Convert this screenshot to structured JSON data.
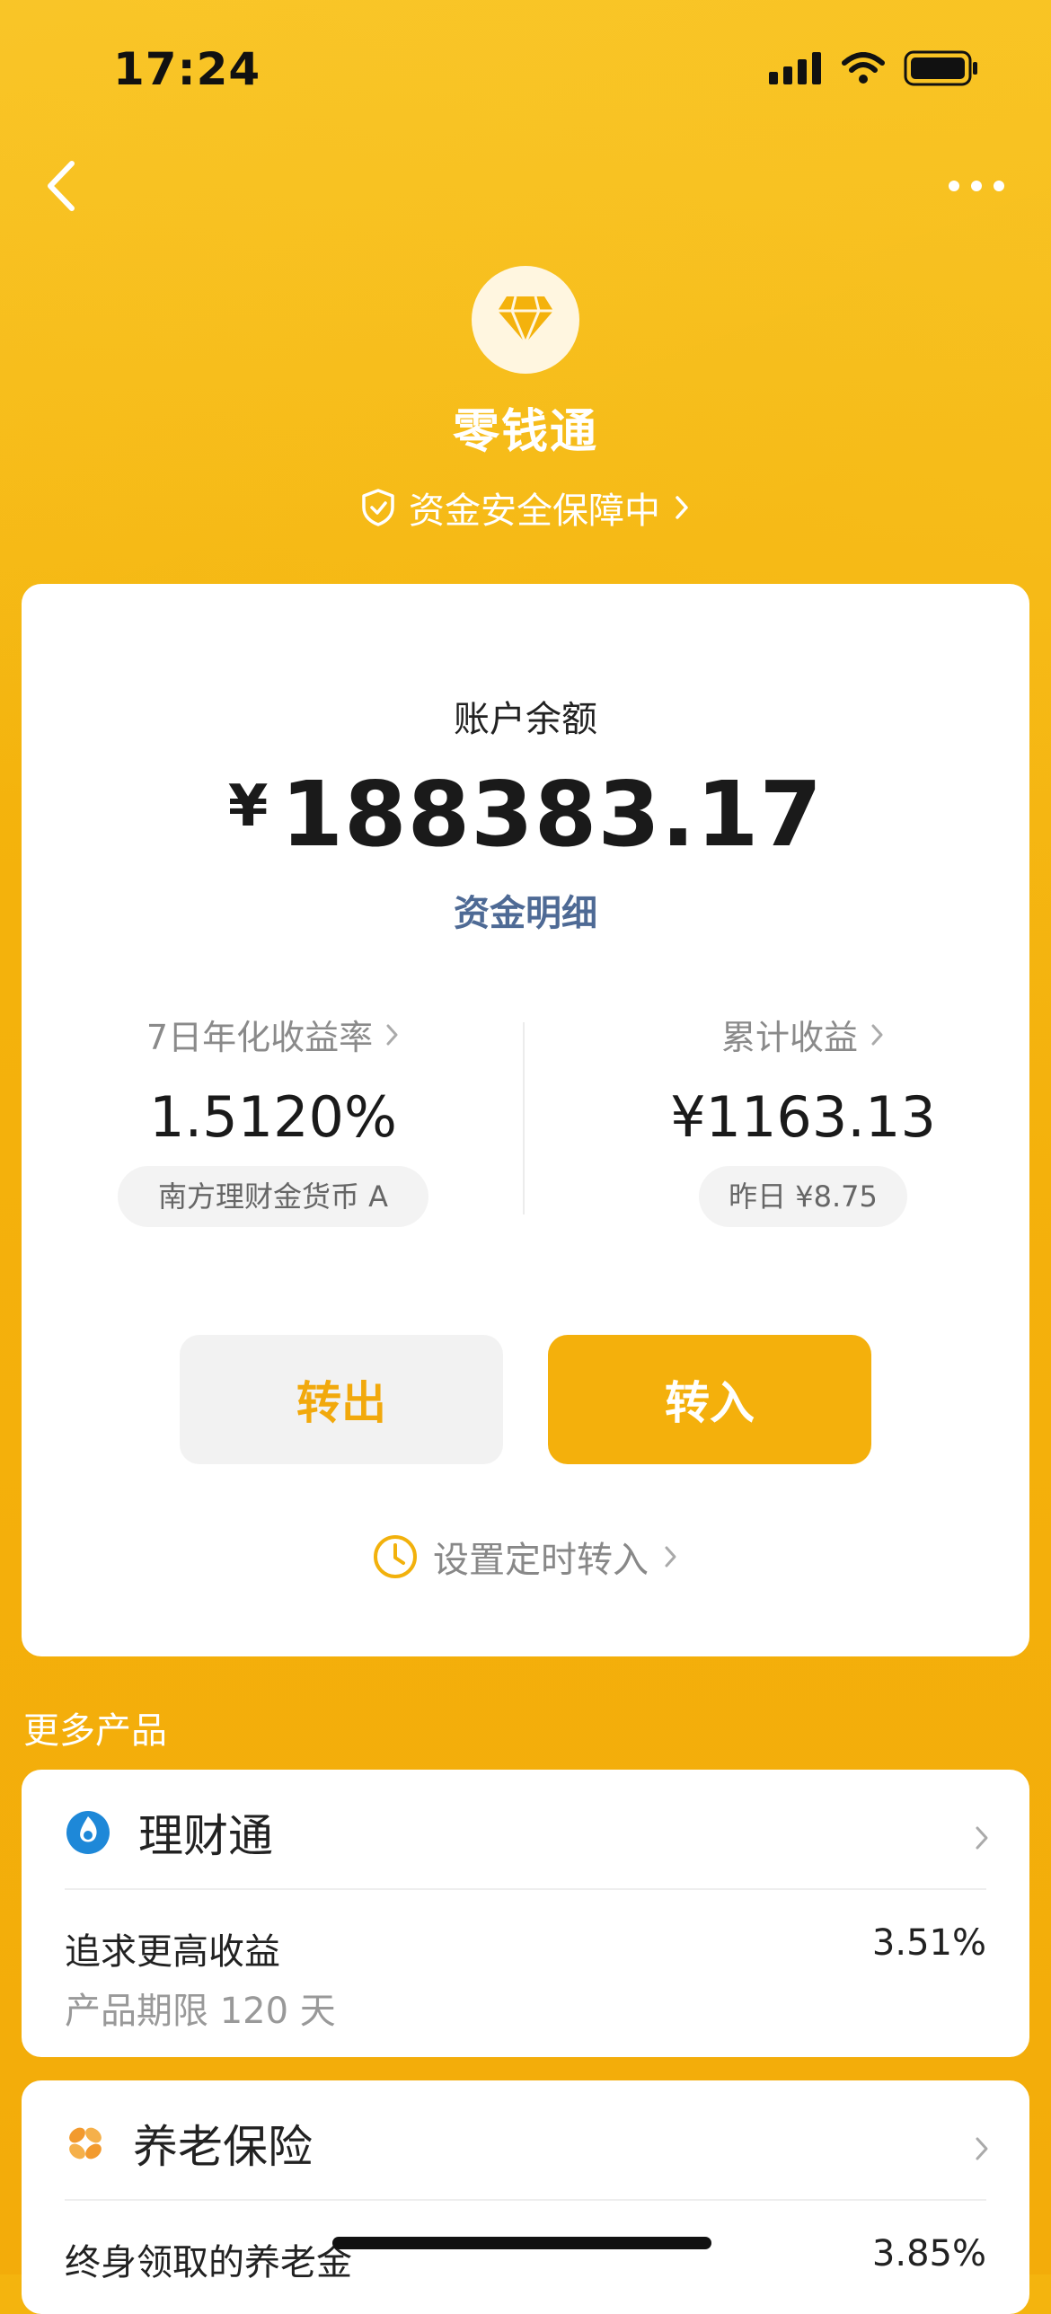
{
  "status_bar": {
    "time": "17:24"
  },
  "header": {
    "product_name": "零钱通",
    "security_text": "资金安全保障中"
  },
  "balance": {
    "label": "账户余额",
    "currency": "¥",
    "amount": "188383.17",
    "detail_link": "资金明细"
  },
  "stats": {
    "yield": {
      "label": "7日年化收益率",
      "value": "1.5120%",
      "fund": "南方理财金货币 A"
    },
    "earnings": {
      "label": "累计收益",
      "value": "¥1163.13",
      "yesterday": "昨日 ¥8.75"
    }
  },
  "actions": {
    "transfer_out": "转出",
    "transfer_in": "转入",
    "schedule": "设置定时转入"
  },
  "more_products": {
    "title": "更多产品",
    "items": [
      {
        "name": "理财通",
        "desc": "追求更高收益",
        "sub": "产品期限 120 天",
        "rate": "3.51%"
      },
      {
        "name": "养老保险",
        "desc": "终身领取的养老金",
        "rate": "3.85%"
      }
    ]
  },
  "colors": {
    "brand": "#F4B40E",
    "link": "#4E6A95",
    "accent": "#F2A90C"
  }
}
